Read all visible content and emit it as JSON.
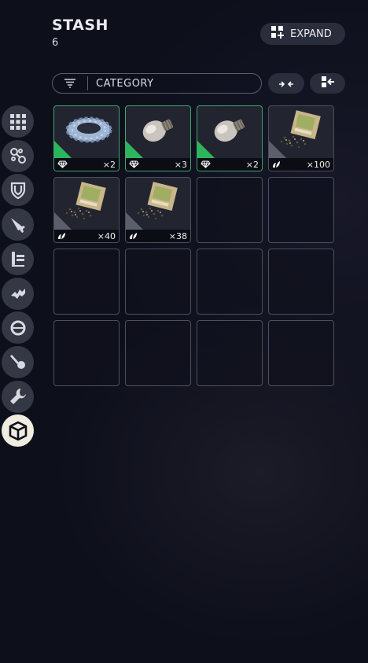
{
  "header": {
    "title": "STASH",
    "count": "6",
    "expand_label": "EXPAND"
  },
  "filter": {
    "label": "CATEGORY"
  },
  "sidebar": {
    "items": [
      {
        "name": "sidebar-item-all",
        "icon": "grid-icon"
      },
      {
        "name": "sidebar-item-attachments",
        "icon": "chain-icon"
      },
      {
        "name": "sidebar-item-armor",
        "icon": "shield-icon"
      },
      {
        "name": "sidebar-item-weapons",
        "icon": "gun-icon"
      },
      {
        "name": "sidebar-item-ammo",
        "icon": "ammo-icon"
      },
      {
        "name": "sidebar-item-mods",
        "icon": "mod-icon"
      },
      {
        "name": "sidebar-item-gear",
        "icon": "ring-icon"
      },
      {
        "name": "sidebar-item-keys",
        "icon": "key-icon"
      },
      {
        "name": "sidebar-item-tools",
        "icon": "wrench-icon"
      },
      {
        "name": "sidebar-item-materials",
        "icon": "box-icon",
        "active": true
      }
    ]
  },
  "slots": [
    {
      "item": "rope-coil",
      "category": "valuable",
      "qty": "×2"
    },
    {
      "item": "light-bulb",
      "category": "valuable",
      "qty": "×3"
    },
    {
      "item": "light-bulb",
      "category": "valuable",
      "qty": "×2"
    },
    {
      "item": "seed-packet",
      "category": "nature",
      "qty": "×100"
    },
    {
      "item": "seed-packet",
      "category": "nature",
      "qty": "×40"
    },
    {
      "item": "seed-packet",
      "category": "nature",
      "qty": "×38"
    }
  ],
  "total_slots": 16,
  "colors": {
    "background": "#0d0f1b",
    "valuable_accent": "#2db55d",
    "nature_accent": "#5b5e6b",
    "active_tab": "#f1ece0"
  }
}
